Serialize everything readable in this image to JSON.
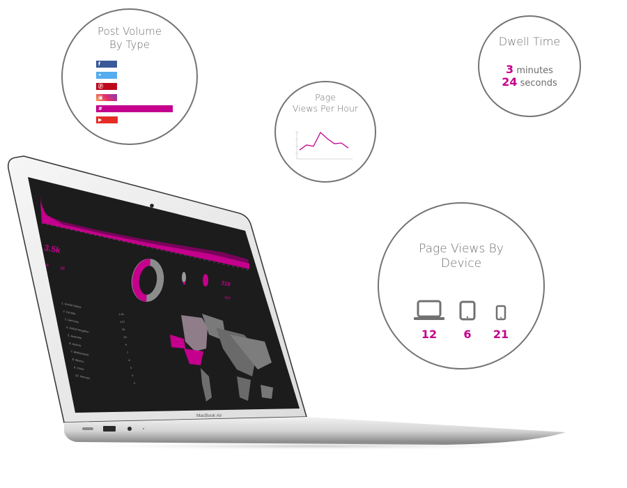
{
  "post_volume": {
    "title_line1": "Post Volume",
    "title_line2": "By Type",
    "bars": [
      {
        "network": "facebook",
        "icon": "f",
        "color": "#3b5998",
        "relative_volume": 0.27
      },
      {
        "network": "twitter",
        "icon": "t",
        "color": "#55acee",
        "relative_volume": 0.27
      },
      {
        "network": "pinterest",
        "icon": "p",
        "color": "#bd081c",
        "relative_volume": 0.27
      },
      {
        "network": "instagram",
        "icon": "i",
        "color": "#d6446a",
        "relative_volume": 0.27
      },
      {
        "network": "hashtag",
        "icon": "#",
        "color": "#c4008c",
        "relative_volume": 1.0
      },
      {
        "network": "youtube",
        "icon": "y",
        "color": "#e52d27",
        "relative_volume": 0.28
      }
    ]
  },
  "views_per_hour": {
    "title_line1": "Page",
    "title_line2": "Views Per Hour",
    "line_color": "#c4008c",
    "points": [
      0.3,
      0.5,
      0.45,
      1.0,
      0.75,
      0.55,
      0.58,
      0.38
    ]
  },
  "dwell_time": {
    "title": "Dwell Time",
    "minutes_value": "3",
    "minutes_label": "minutes",
    "seconds_value": "24",
    "seconds_label": "seconds"
  },
  "by_device": {
    "title_line1": "Page Views By",
    "title_line2": "Device",
    "devices": [
      {
        "device": "laptop",
        "value": "12"
      },
      {
        "device": "tablet",
        "value": "6"
      },
      {
        "device": "phone",
        "value": "21"
      }
    ]
  },
  "laptop": {
    "brand_label": "MacBook Air",
    "screen": {
      "big_stat": "3.5k",
      "dwell_small_a": "0",
      "dwell_small_b": "32",
      "stat_a": "319",
      "stat_b": "427",
      "country_list": [
        "United States",
        "Canada",
        "Germany",
        "United Kingdom",
        "Australia",
        "Austria",
        "Netherlands",
        "Mexico",
        "China",
        "Vietnam"
      ],
      "country_values": [
        "1.4k",
        "127",
        "76",
        "39",
        "9",
        "7",
        "6",
        "5",
        "5",
        "3"
      ],
      "accent": "#c4008c"
    }
  }
}
